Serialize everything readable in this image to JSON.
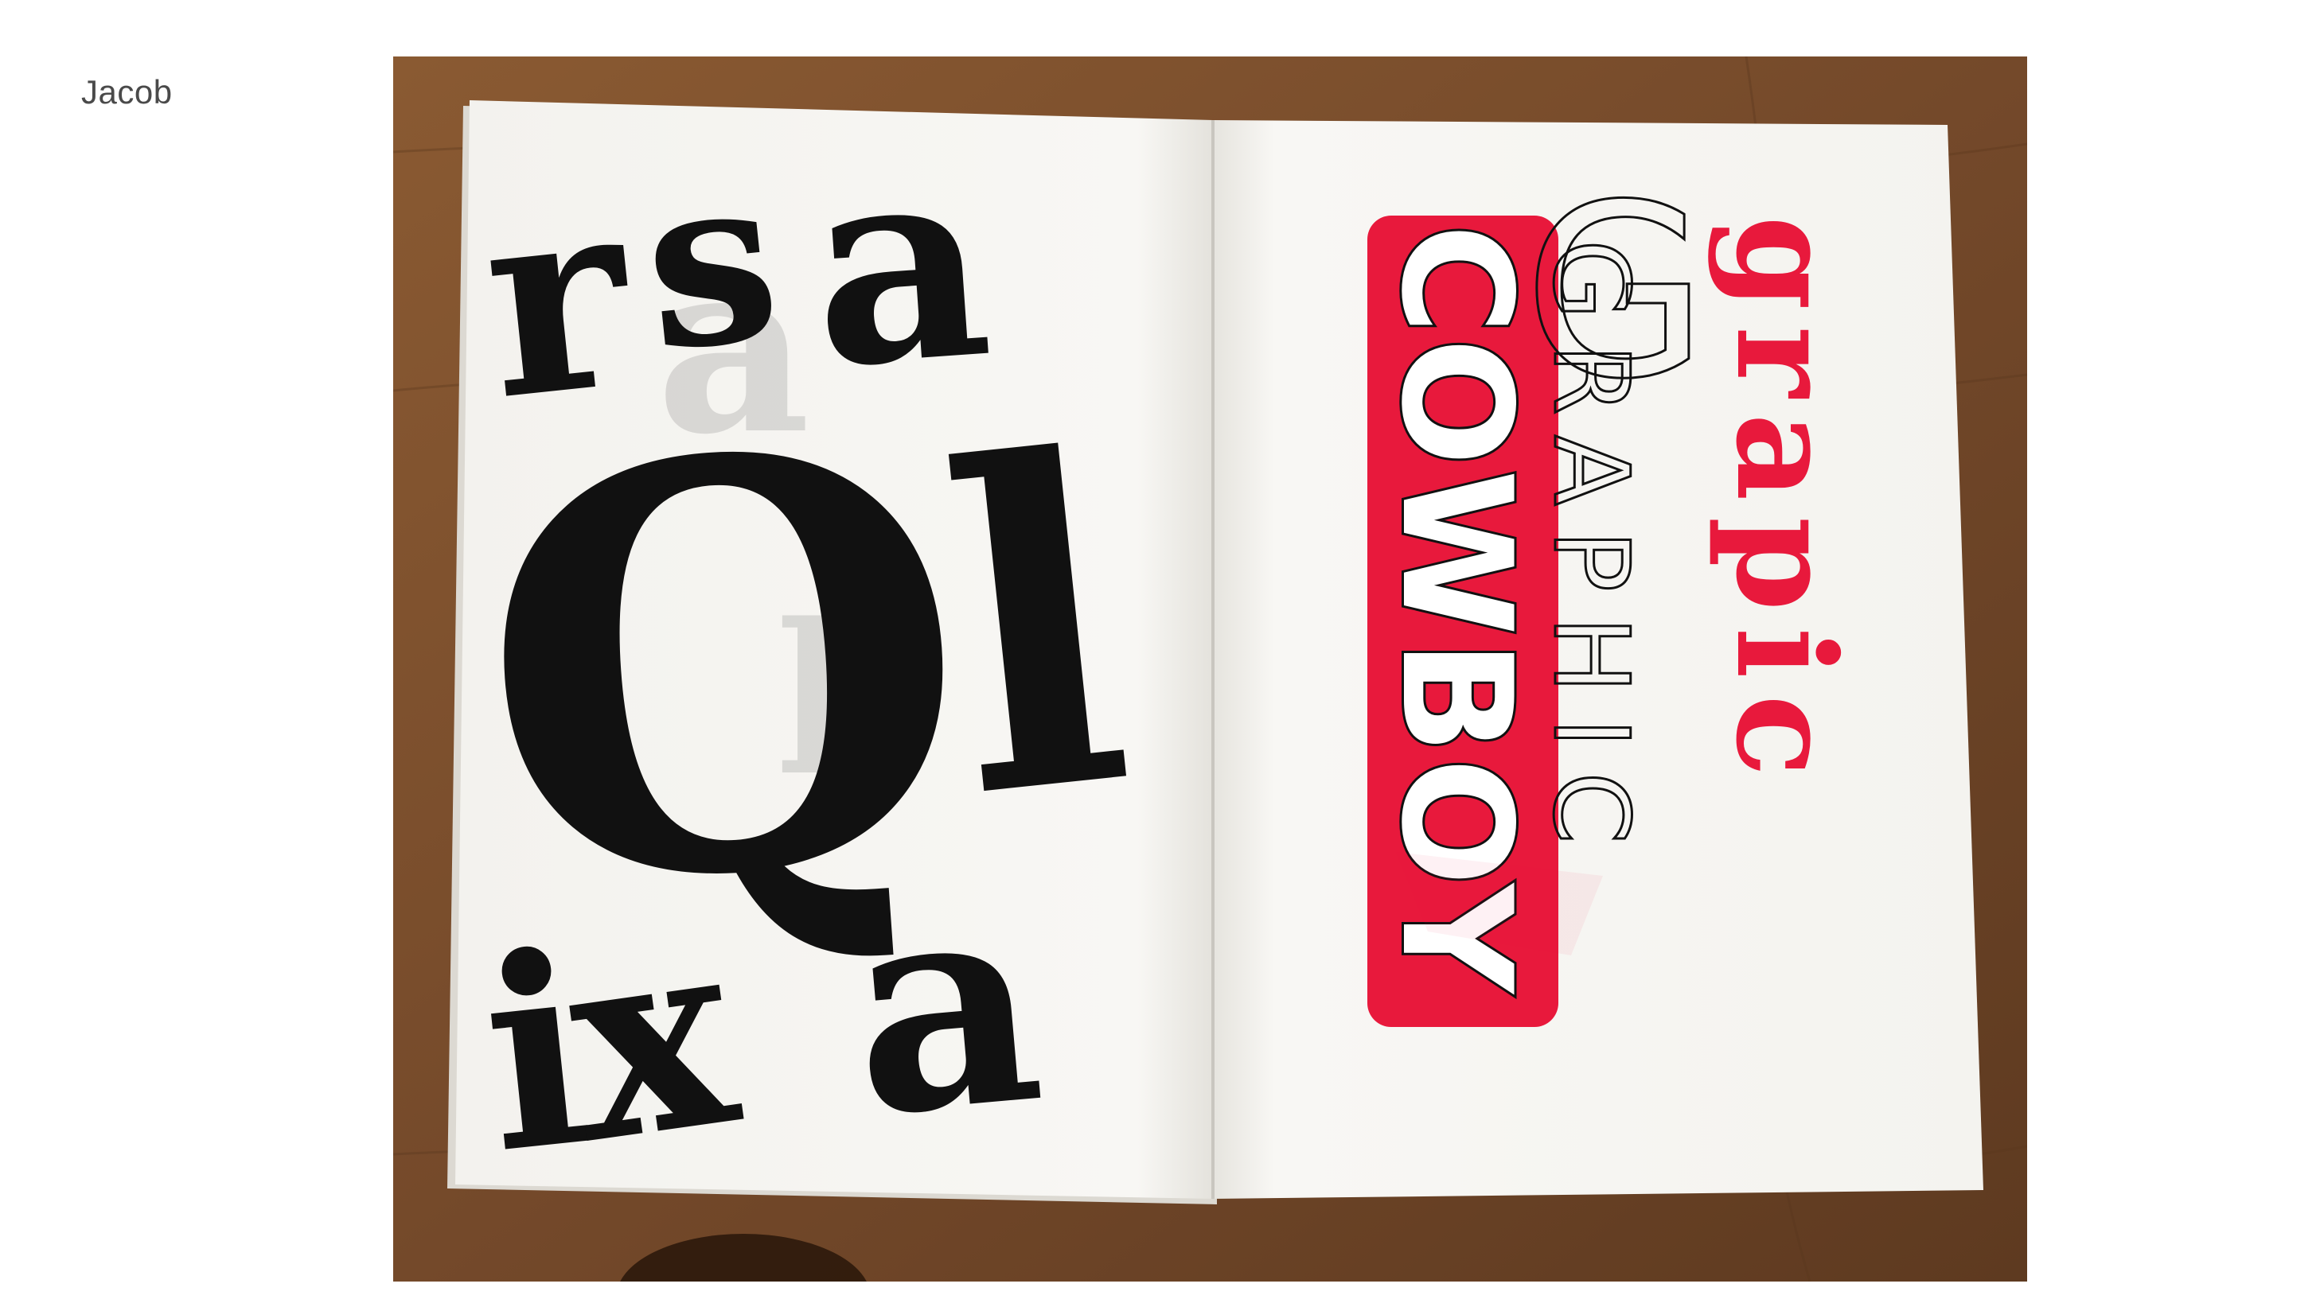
{
  "slide": {
    "author": "Jacob"
  },
  "photo": {
    "left_page_letters": [
      "r",
      "s",
      "a",
      "Q",
      "l",
      "i",
      "x",
      "a"
    ],
    "right_page": {
      "red_outlined_word": "COWBOY",
      "outline_word": "GRAPHIC",
      "red_serif_word": "grapic"
    },
    "colors": {
      "wood": "#7a4f2c",
      "paper": "#f7f6f2",
      "ink": "#111111",
      "red": "#e8193c"
    }
  }
}
